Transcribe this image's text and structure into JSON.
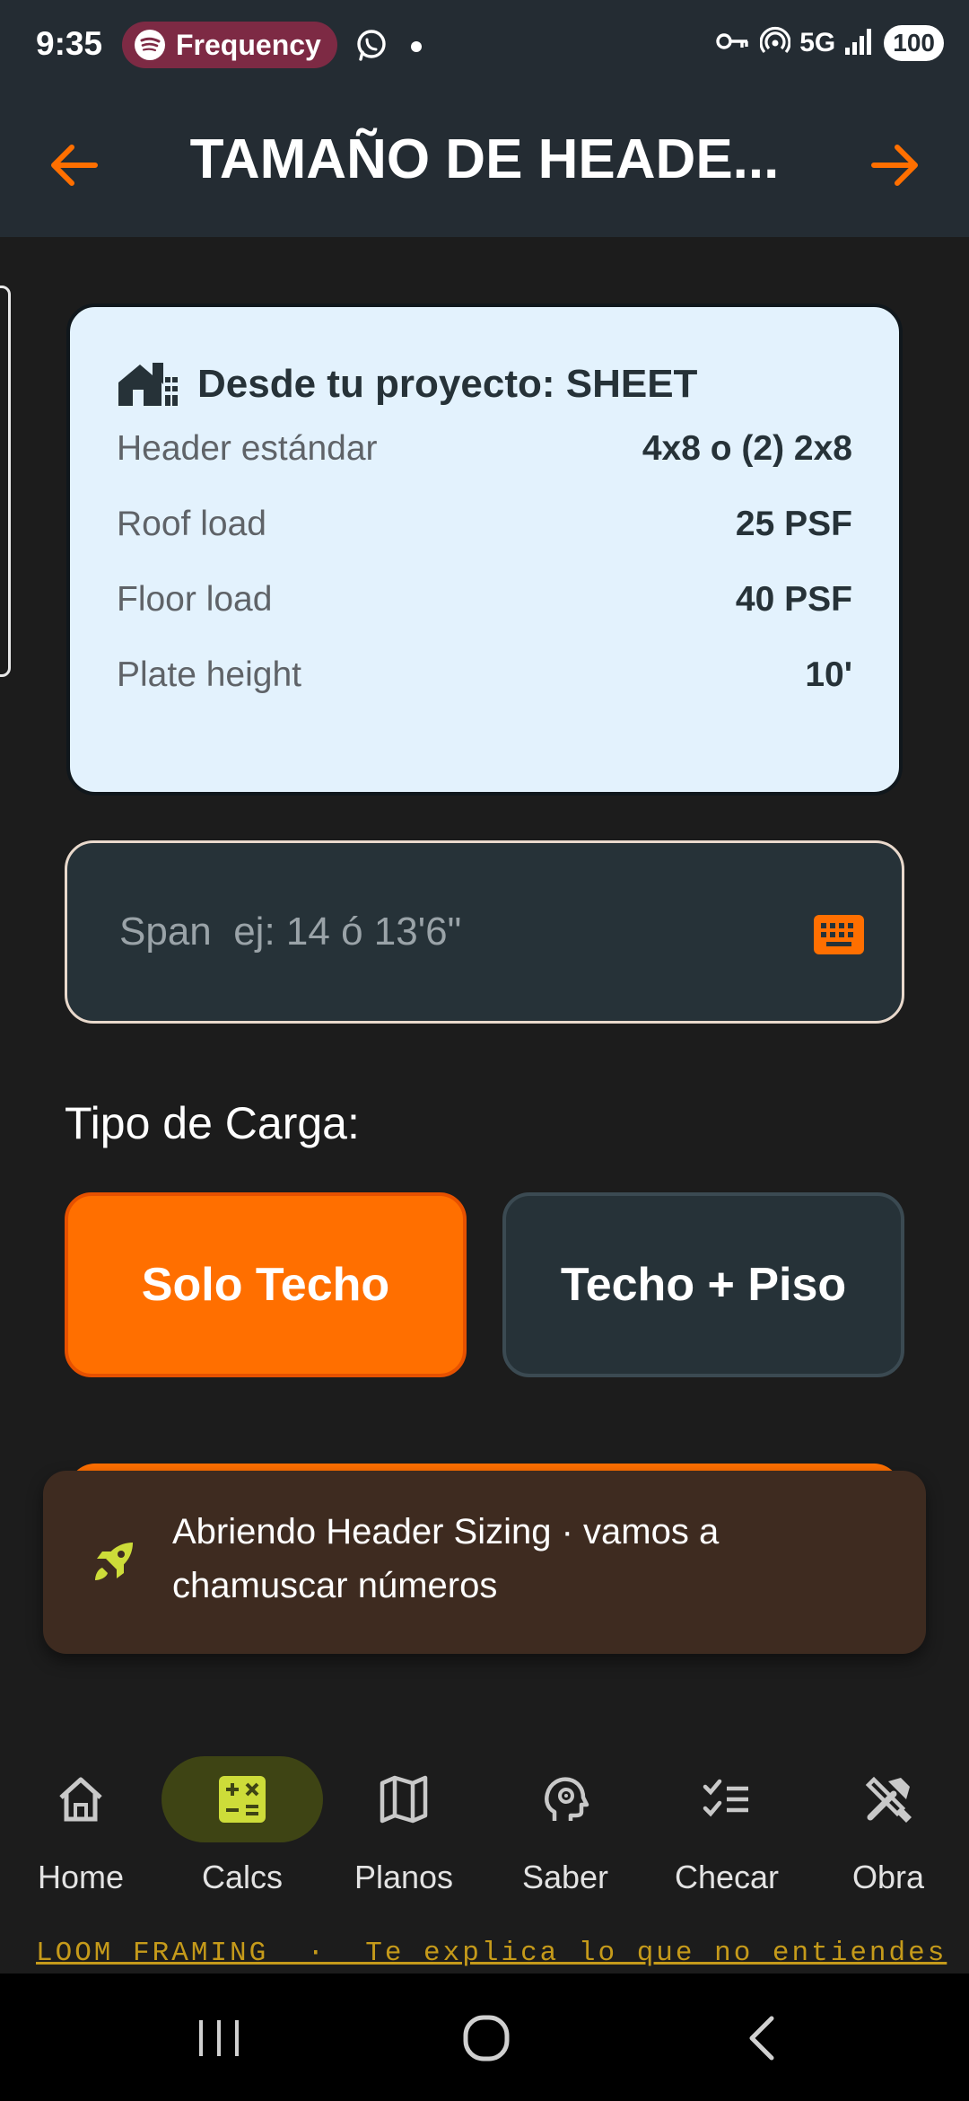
{
  "status_bar": {
    "time": "9:35",
    "media_pill": {
      "icon": "spotify-icon",
      "label": "Frequency"
    },
    "notification_icons": [
      "whatsapp-icon",
      "dot-icon"
    ],
    "right_icons": [
      "vpn-key-icon",
      "hotspot-icon",
      "signal-icon"
    ],
    "network": "5G",
    "battery": "100"
  },
  "app_bar": {
    "title": "TAMAÑO DE HEADE...",
    "back_icon": "arrow-left-icon",
    "forward_icon": "arrow-right-icon",
    "accent": "#ff6f00"
  },
  "project_card": {
    "icon": "house-icon",
    "title": "Desde tu proyecto: SHEET",
    "rows": [
      {
        "label": "Header estándar",
        "value": "4x8 o (2) 2x8"
      },
      {
        "label": "Roof load",
        "value": "25 PSF"
      },
      {
        "label": "Floor load",
        "value": "40 PSF"
      },
      {
        "label": "Plate height",
        "value": "10'"
      }
    ]
  },
  "span_input": {
    "placeholder": "Span  ej: 14 ó 13'6\"",
    "value": "",
    "icon": "keyboard-icon"
  },
  "load_type": {
    "label": "Tipo de Carga:",
    "options": [
      {
        "label": "Solo Techo",
        "selected": true
      },
      {
        "label": "Techo + Piso",
        "selected": false
      }
    ]
  },
  "snackbar": {
    "icon": "rocket-icon",
    "message": "Abriendo Header Sizing · vamos a chamuscar números"
  },
  "bottom_nav": {
    "items": [
      {
        "label": "Home",
        "icon": "home-icon",
        "active": false
      },
      {
        "label": "Calcs",
        "icon": "calculator-icon",
        "active": true
      },
      {
        "label": "Planos",
        "icon": "map-icon",
        "active": false
      },
      {
        "label": "Saber",
        "icon": "brain-head-icon",
        "active": false
      },
      {
        "label": "Checar",
        "icon": "checklist-icon",
        "active": false
      },
      {
        "label": "Obra",
        "icon": "tools-icon",
        "active": false
      }
    ]
  },
  "footer_marquee": "LOOM FRAMING  ·  Te explica lo que no entiendes",
  "system_nav": [
    "recents-icon",
    "home-circle-icon",
    "back-chevron-icon"
  ],
  "colors": {
    "accent_orange": "#ff6f00",
    "card_bg": "#e3f2fd",
    "surface": "#263238",
    "background": "#1c1c1c",
    "nav_active": "#3e4414",
    "calc_icon": "#cddc39",
    "snackbar_bg": "#3e2b20"
  }
}
